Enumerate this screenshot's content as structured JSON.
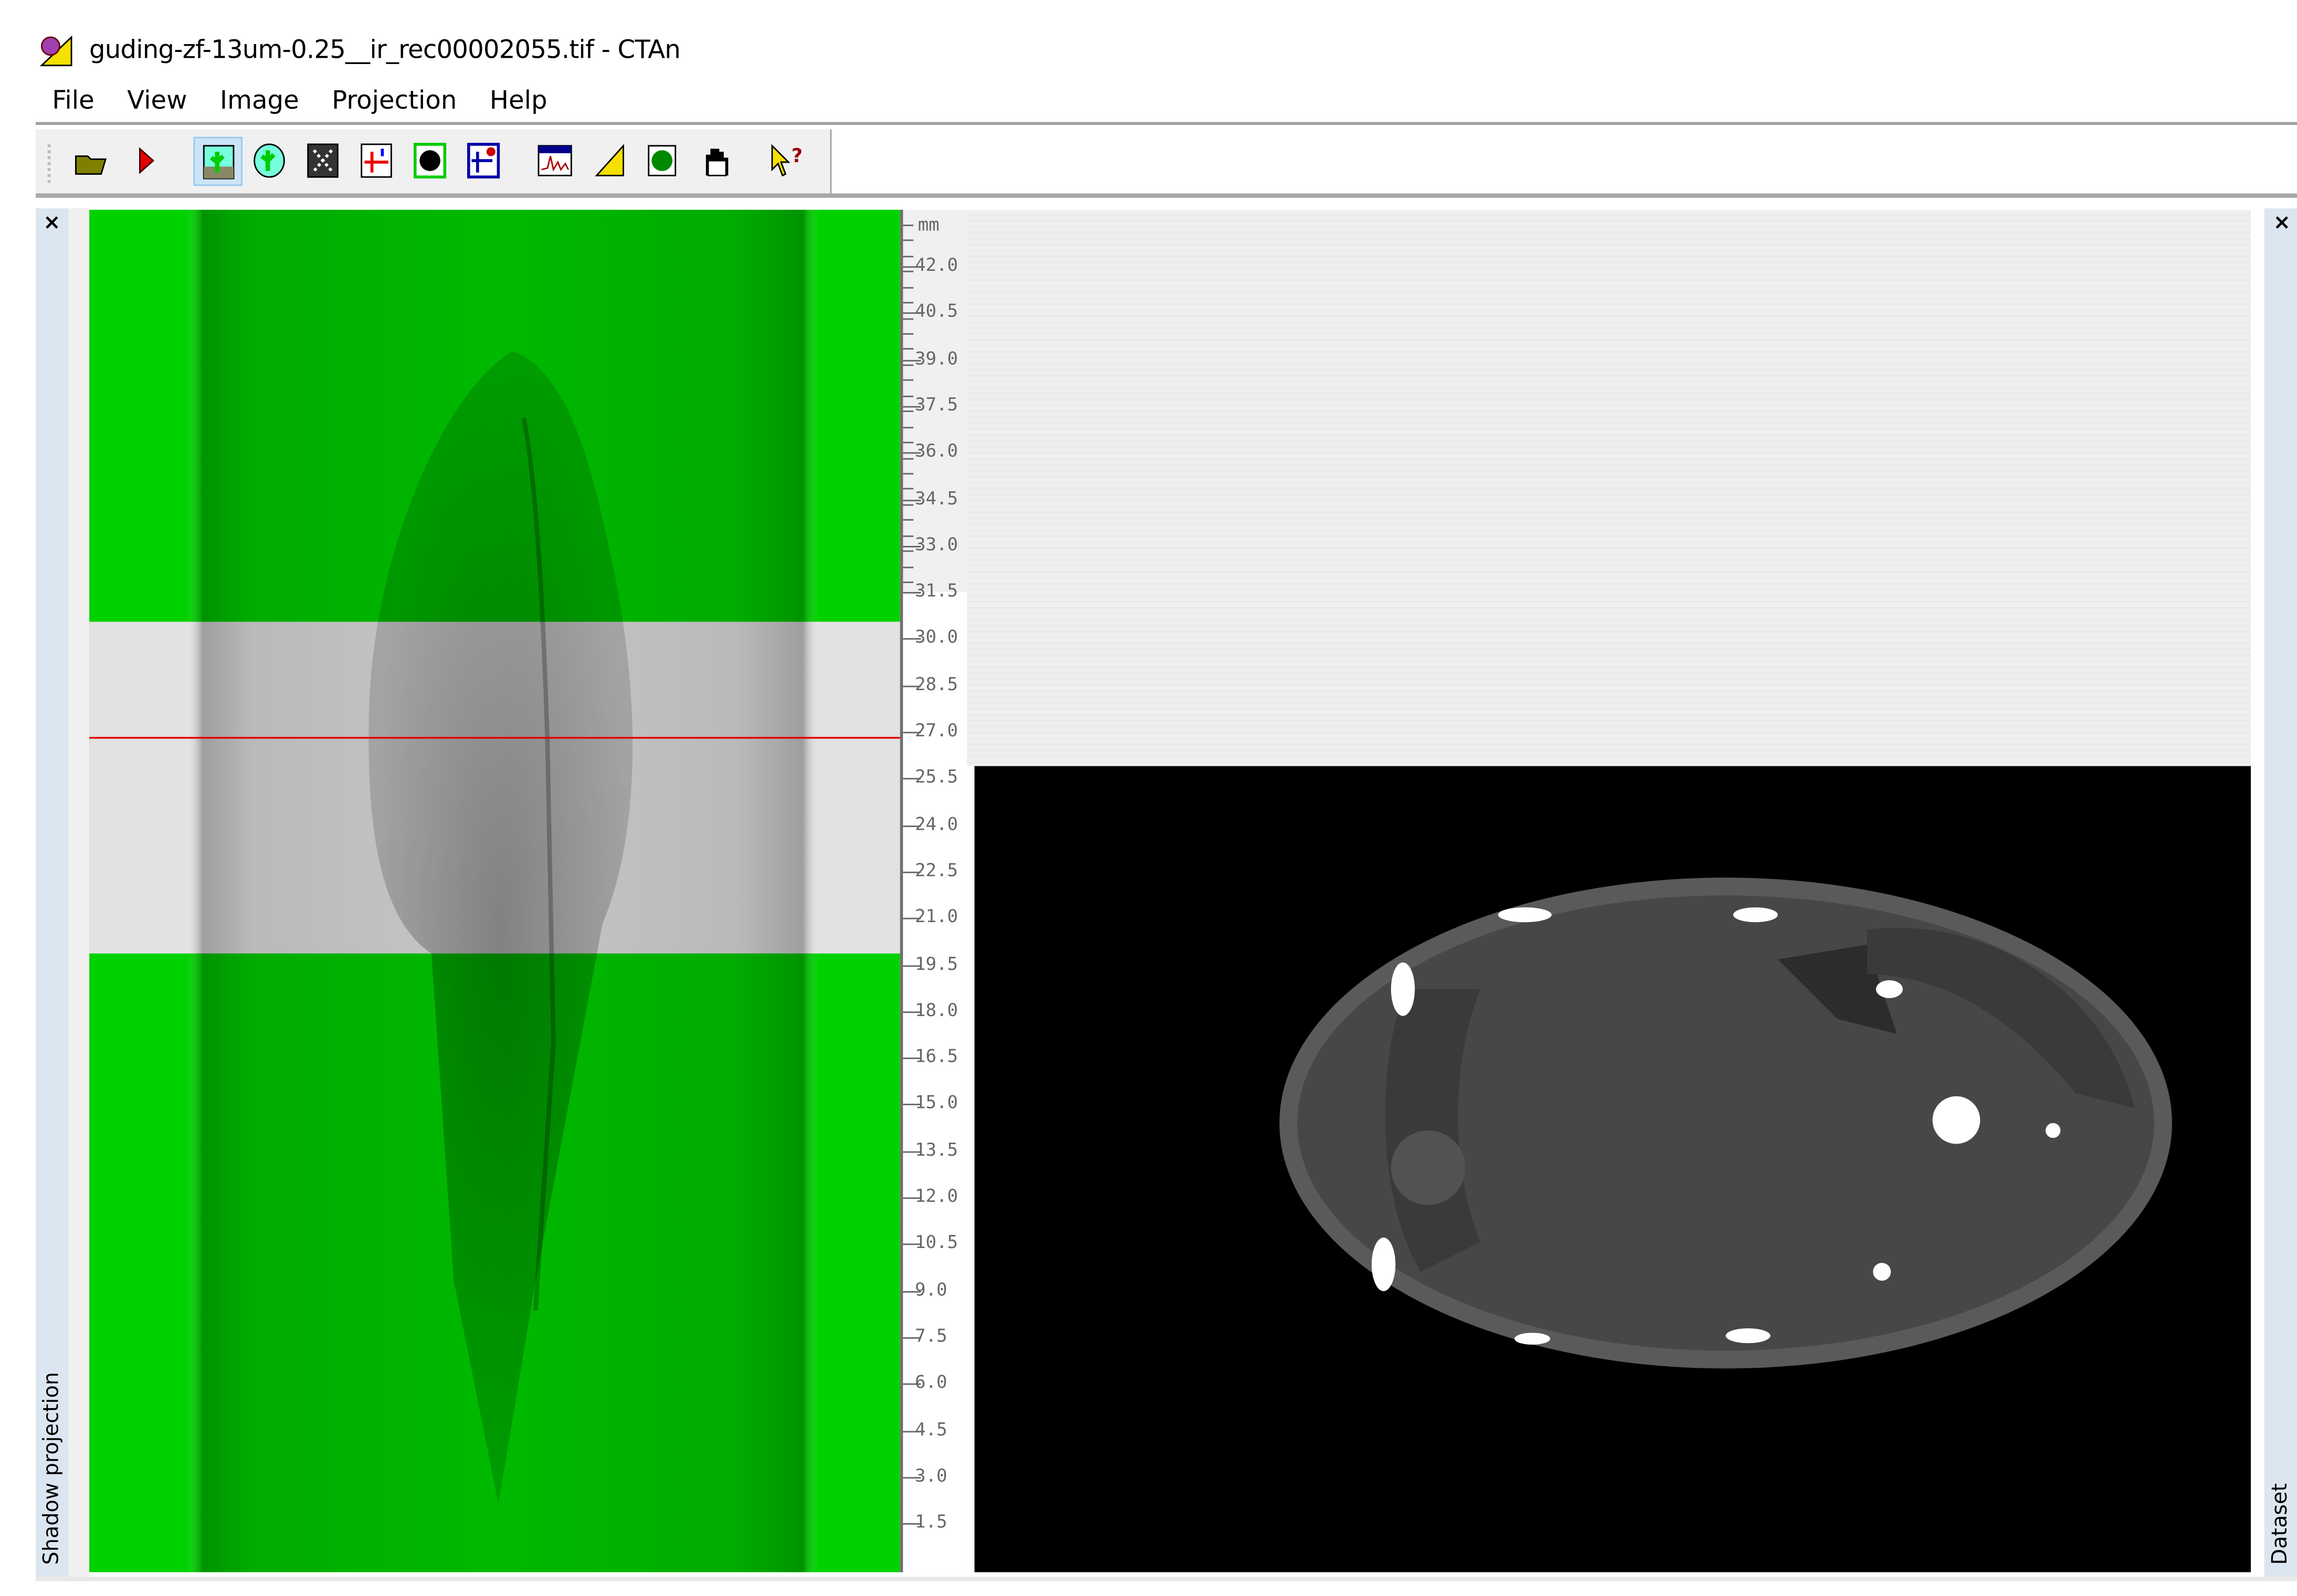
{
  "window": {
    "title": "guding-zf-13um-0.25__ir_rec00002055.tif - CTAn"
  },
  "menu": [
    "File",
    "View",
    "Image",
    "Projection",
    "Help"
  ],
  "toolbar": [
    {
      "icon": "open-folder-icon"
    },
    {
      "icon": "play-icon"
    },
    {
      "icon": "raw-image-icon",
      "active": true
    },
    {
      "icon": "roi-icon"
    },
    {
      "icon": "binary-image-icon"
    },
    {
      "icon": "morphometry-icon"
    },
    {
      "icon": "custom-processing-icon"
    },
    {
      "icon": "3d-analysis-icon"
    },
    {
      "icon": "histogram-icon"
    },
    {
      "icon": "measure-icon"
    },
    {
      "icon": "3d-model-icon"
    },
    {
      "icon": "hand-pan-icon"
    },
    {
      "icon": "context-help-icon"
    }
  ],
  "left_panel": {
    "label": "Shadow projection",
    "close": "×"
  },
  "right_panel": {
    "label": "Dataset",
    "close": "×"
  },
  "ruler": {
    "unit": "mm",
    "labels": [
      "42.0",
      "40.5",
      "39.0",
      "37.5",
      "36.0",
      "34.5",
      "33.0",
      "31.5",
      "30.0",
      "28.5",
      "27.0",
      "25.5",
      "24.0",
      "22.5",
      "21.0",
      "19.5",
      "18.0",
      "16.5",
      "15.0",
      "13.5",
      "12.0",
      "10.5",
      "9.0",
      "7.5",
      "6.0",
      "4.5",
      "3.0",
      "1.5"
    ]
  },
  "colors": {
    "projection_green": "#00d800",
    "slice_line": "#e00000"
  }
}
